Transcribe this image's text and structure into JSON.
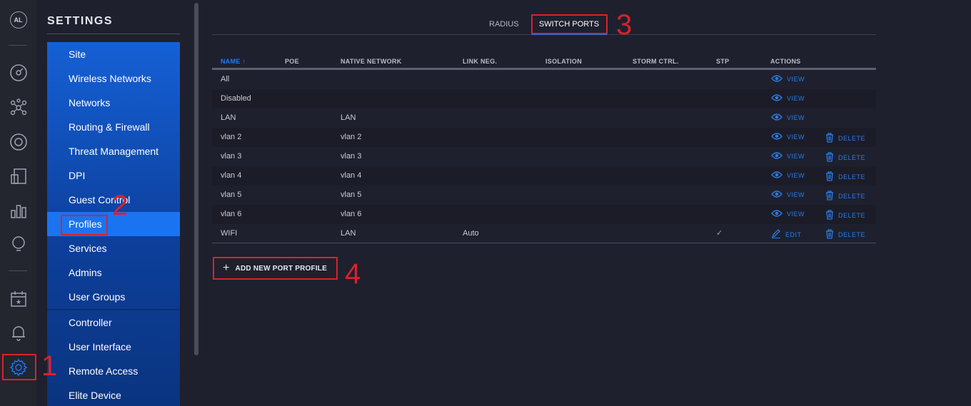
{
  "rail": {
    "avatar": "AL",
    "icons": [
      "dashboard-icon",
      "topology-icon",
      "devices-icon",
      "clients-icon",
      "statistics-icon",
      "insights-icon",
      "events-icon",
      "alerts-icon",
      "settings-icon"
    ]
  },
  "settings": {
    "title": "SETTINGS",
    "items": [
      {
        "label": "Site"
      },
      {
        "label": "Wireless Networks"
      },
      {
        "label": "Networks"
      },
      {
        "label": "Routing & Firewall"
      },
      {
        "label": "Threat Management"
      },
      {
        "label": "DPI"
      },
      {
        "label": "Guest Control"
      },
      {
        "label": "Profiles",
        "active": true
      },
      {
        "label": "Services"
      },
      {
        "label": "Admins"
      },
      {
        "label": "User Groups"
      }
    ],
    "items2": [
      {
        "label": "Controller"
      },
      {
        "label": "User Interface"
      },
      {
        "label": "Remote Access"
      },
      {
        "label": "Elite Device"
      }
    ]
  },
  "tabs": {
    "radius": "RADIUS",
    "switch_ports": "SWITCH PORTS"
  },
  "table": {
    "columns": [
      "NAME",
      "POE",
      "NATIVE NETWORK",
      "LINK NEG.",
      "ISOLATION",
      "STORM CTRL.",
      "STP",
      "ACTIONS"
    ],
    "sort_indicator": "↑",
    "rows": [
      {
        "name": "All",
        "native": "",
        "link": "",
        "stp": "",
        "action": "VIEW",
        "delete": ""
      },
      {
        "name": "Disabled",
        "native": "",
        "link": "",
        "stp": "",
        "action": "VIEW",
        "delete": ""
      },
      {
        "name": "LAN",
        "native": "LAN",
        "link": "",
        "stp": "",
        "action": "VIEW",
        "delete": ""
      },
      {
        "name": "vlan 2",
        "native": "vlan 2",
        "link": "",
        "stp": "",
        "action": "VIEW",
        "delete": "DELETE"
      },
      {
        "name": "vlan 3",
        "native": "vlan 3",
        "link": "",
        "stp": "",
        "action": "VIEW",
        "delete": "DELETE"
      },
      {
        "name": "vlan 4",
        "native": "vlan 4",
        "link": "",
        "stp": "",
        "action": "VIEW",
        "delete": "DELETE"
      },
      {
        "name": "vlan 5",
        "native": "vlan 5",
        "link": "",
        "stp": "",
        "action": "VIEW",
        "delete": "DELETE"
      },
      {
        "name": "vlan 6",
        "native": "vlan 6",
        "link": "",
        "stp": "",
        "action": "VIEW",
        "delete": "DELETE"
      },
      {
        "name": "WIFI",
        "native": "LAN",
        "link": "Auto",
        "stp": "✓",
        "action": "EDIT",
        "delete": "DELETE"
      }
    ]
  },
  "add_button": {
    "label": "ADD NEW PORT PROFILE"
  },
  "annotations": [
    "1",
    "2",
    "3",
    "4"
  ],
  "colors": {
    "accent": "#1a74f2",
    "annotation": "#d9222a"
  }
}
